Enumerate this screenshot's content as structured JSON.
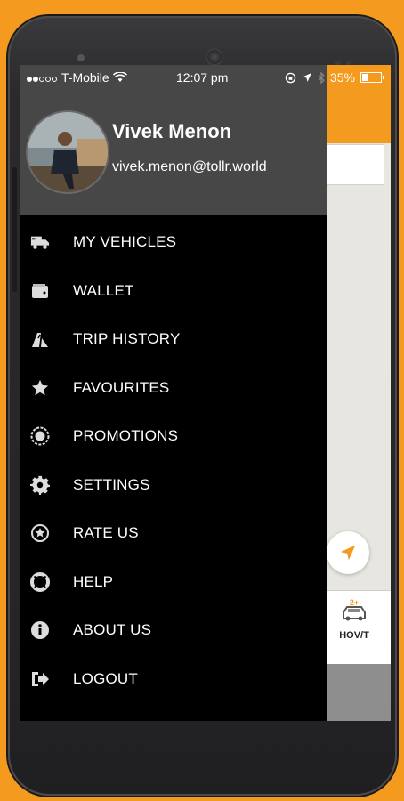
{
  "status_bar": {
    "carrier": "T-Mobile",
    "time": "12:07 pm",
    "battery": "35%",
    "battery_level": 0.35
  },
  "user": {
    "name": "Vivek Menon",
    "email": "vivek.menon@tollr.world"
  },
  "menu": {
    "items": [
      {
        "label": "MY VEHICLES",
        "icon": "truck-icon"
      },
      {
        "label": "WALLET",
        "icon": "wallet-icon"
      },
      {
        "label": "TRIP HISTORY",
        "icon": "road-icon"
      },
      {
        "label": "FAVOURITES",
        "icon": "star-icon"
      },
      {
        "label": "PROMOTIONS",
        "icon": "badge-icon"
      },
      {
        "label": "SETTINGS",
        "icon": "gear-icon"
      },
      {
        "label": "RATE US",
        "icon": "star-circle-icon"
      },
      {
        "label": "HELP",
        "icon": "lifebuoy-icon"
      },
      {
        "label": "ABOUT US",
        "icon": "info-icon"
      },
      {
        "label": "LOGOUT",
        "icon": "logout-icon"
      }
    ]
  },
  "background_app": {
    "lane_option_label": "HOV/T",
    "lane_option_badge": "2+"
  },
  "colors": {
    "accent": "#F39A1F",
    "drawer_bg": "#000000",
    "header_bg": "#474747"
  }
}
